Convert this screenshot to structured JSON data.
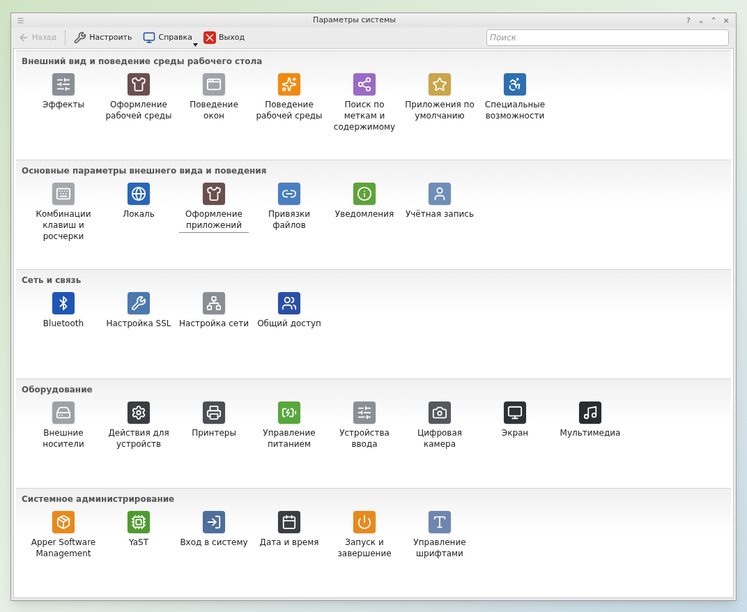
{
  "window": {
    "title": "Параметры системы",
    "controls": [
      "?",
      "⌄",
      "⌃",
      "×"
    ]
  },
  "toolbar": {
    "back": {
      "label": "Назад",
      "disabled": true
    },
    "buttons": [
      {
        "label": "Настроить",
        "has_menu": false
      },
      {
        "label": "Справка",
        "has_menu": true
      },
      {
        "label": "Выход",
        "has_menu": false
      }
    ],
    "search": {
      "placeholder": "Поиск"
    }
  },
  "sections": [
    {
      "title": "Внешний вид и поведение среды рабочего стола",
      "items": [
        {
          "label": "Эффекты",
          "selected": false
        },
        {
          "label": "Оформление рабочей среды",
          "selected": false
        },
        {
          "label": "Поведение окон",
          "selected": false
        },
        {
          "label": "Поведение рабочей среды",
          "selected": false
        },
        {
          "label": "Поиск по меткам и содержимому",
          "selected": false
        },
        {
          "label": "Приложения по умолчанию",
          "selected": false
        },
        {
          "label": "Специальные возможности",
          "selected": false
        }
      ]
    },
    {
      "title": "Основные параметры внешнего вида и поведения",
      "items": [
        {
          "label": "Комбинации клавиш и росчерки",
          "selected": false
        },
        {
          "label": "Локаль",
          "selected": false
        },
        {
          "label": "Оформление приложений",
          "selected": true
        },
        {
          "label": "Привязки файлов",
          "selected": false
        },
        {
          "label": "Уведомления",
          "selected": false
        },
        {
          "label": "Учётная запись",
          "selected": false
        }
      ]
    },
    {
      "title": "Сеть и связь",
      "items": [
        {
          "label": "Bluetooth",
          "selected": false
        },
        {
          "label": "Настройка SSL",
          "selected": false
        },
        {
          "label": "Настройка сети",
          "selected": false
        },
        {
          "label": "Общий доступ",
          "selected": false
        }
      ]
    },
    {
      "title": "Оборудование",
      "items": [
        {
          "label": "Внешние носители",
          "selected": false
        },
        {
          "label": "Действия для устройств",
          "selected": false
        },
        {
          "label": "Принтеры",
          "selected": false
        },
        {
          "label": "Управление питанием",
          "selected": false
        },
        {
          "label": "Устройства ввода",
          "selected": false
        },
        {
          "label": "Цифровая камера",
          "selected": false
        },
        {
          "label": "Экран",
          "selected": false
        },
        {
          "label": "Мультимедиа",
          "selected": false
        }
      ]
    },
    {
      "title": "Системное администрирование",
      "items": [
        {
          "label": "Apper Software Management",
          "selected": false
        },
        {
          "label": "YaST",
          "selected": false
        },
        {
          "label": "Вход в систему",
          "selected": false
        },
        {
          "label": "Дата и время",
          "selected": false
        },
        {
          "label": "Запуск и завершение",
          "selected": false
        },
        {
          "label": "Управление шрифтами",
          "selected": false
        }
      ]
    }
  ]
}
